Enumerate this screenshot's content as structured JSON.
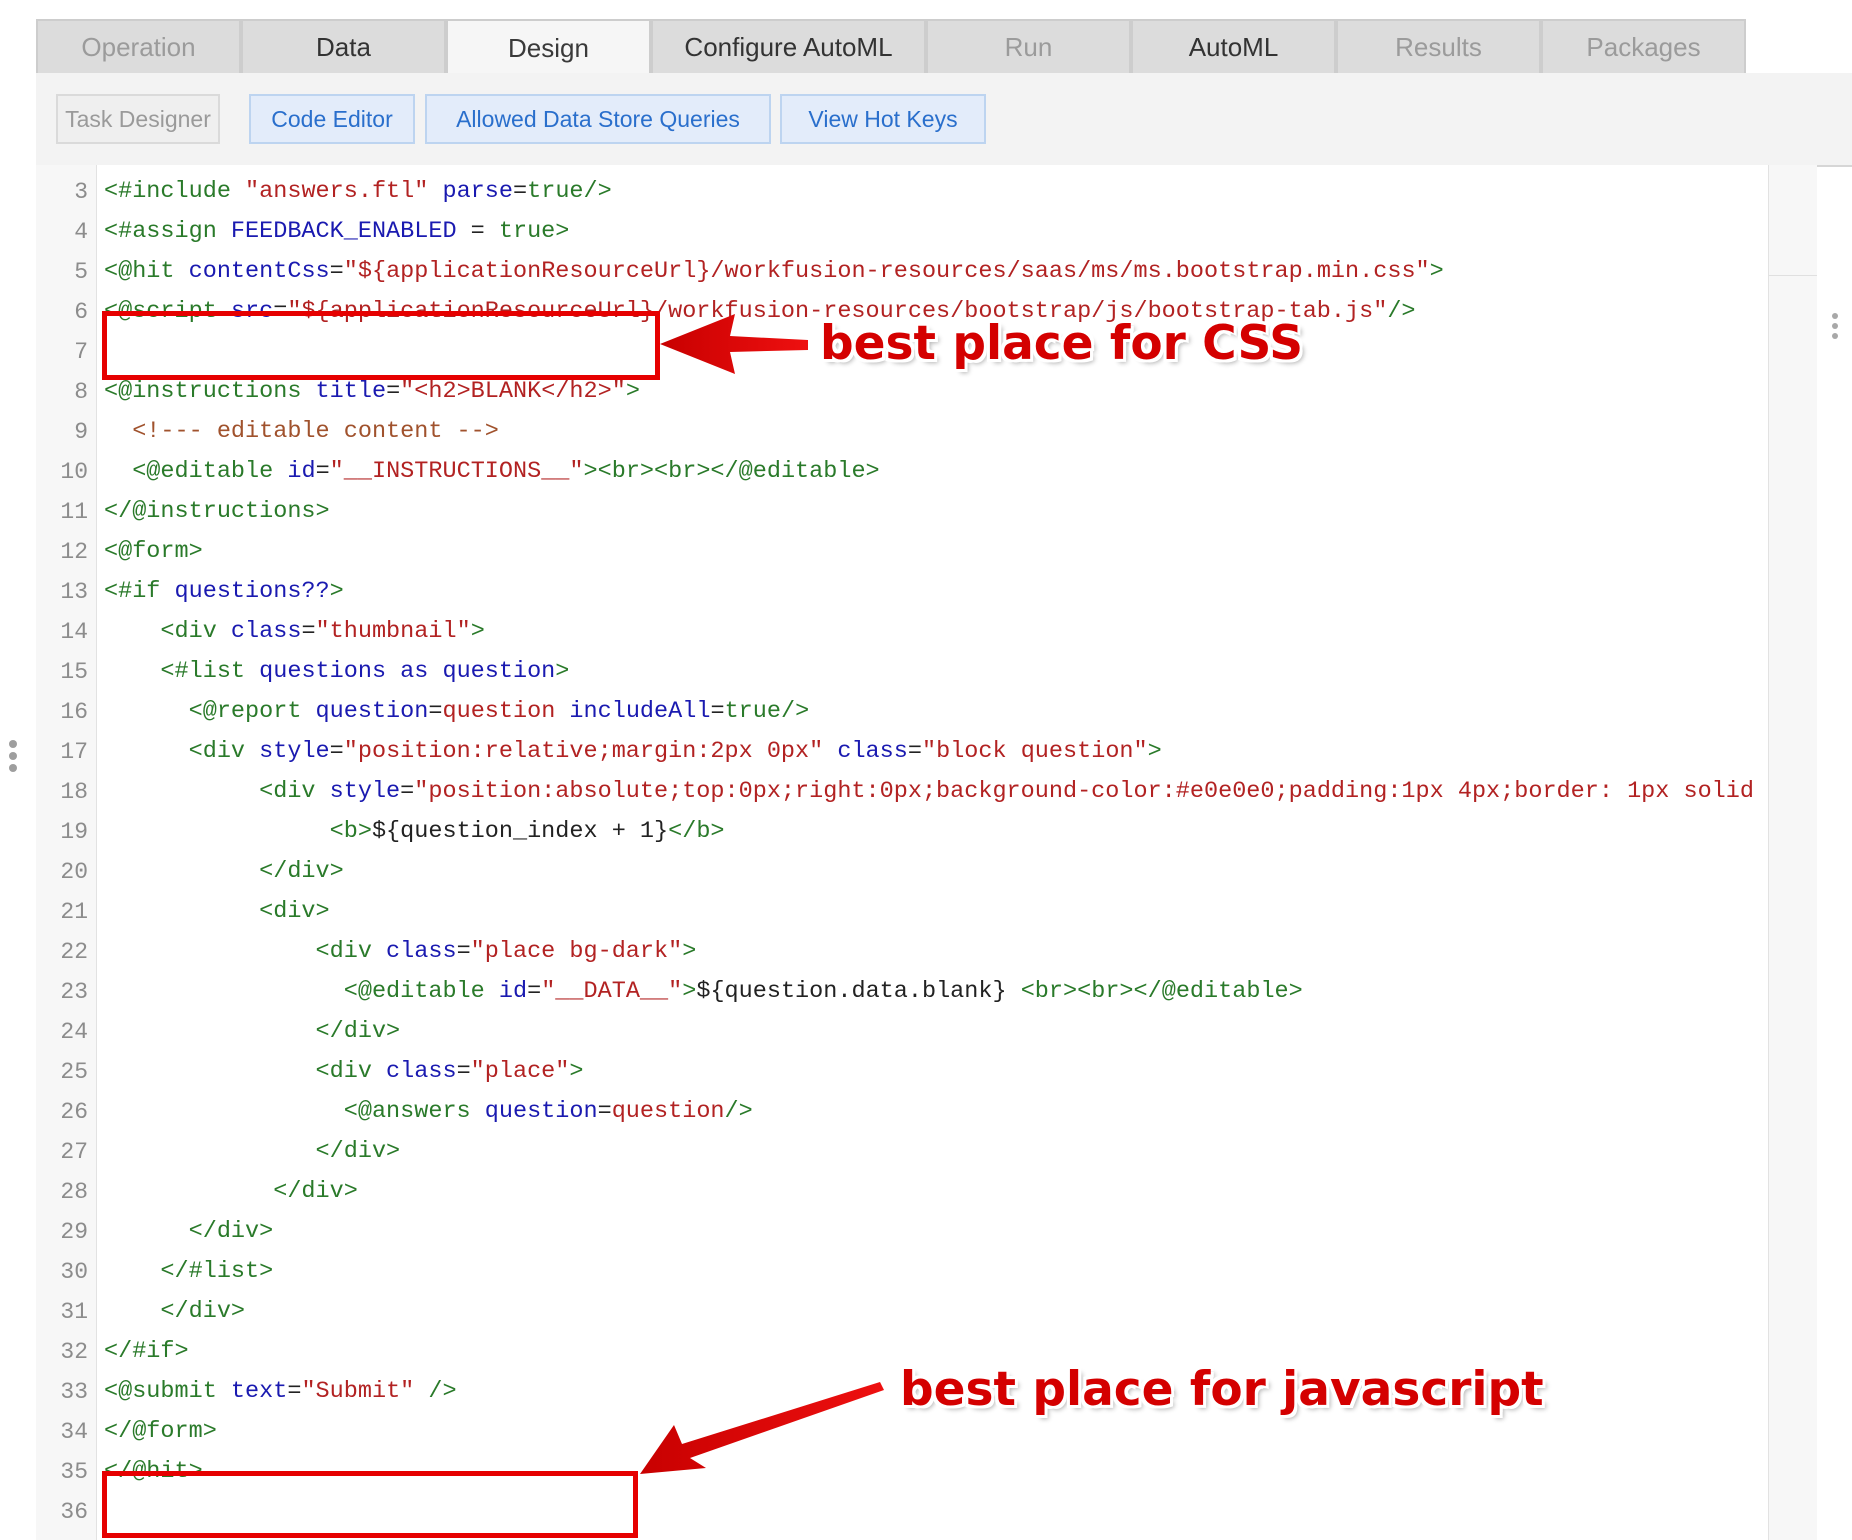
{
  "tabs": [
    {
      "label": "Operation",
      "state": "muted"
    },
    {
      "label": "Data",
      "state": "normal"
    },
    {
      "label": "Design",
      "state": "active"
    },
    {
      "label": "Configure AutoML",
      "state": "normal"
    },
    {
      "label": "Run",
      "state": "muted"
    },
    {
      "label": "AutoML",
      "state": "normal"
    },
    {
      "label": "Results",
      "state": "muted"
    },
    {
      "label": "Packages",
      "state": "muted"
    }
  ],
  "toolbar": {
    "task_designer": "Task Designer",
    "code_editor": "Code Editor",
    "allowed_queries": "Allowed Data Store Queries",
    "hot_keys": "View Hot Keys"
  },
  "colors": {
    "directive": "#2a7a2a",
    "name": "#1a1ab0",
    "string": "#b22222",
    "comment": "#a0522d",
    "plain": "#222222",
    "annotation": "#e60000"
  },
  "code_lines": [
    {
      "n": "3",
      "tokens": [
        [
          "d",
          "<#include "
        ],
        [
          "s",
          "\"answers.ftl\""
        ],
        [
          "n",
          " parse"
        ],
        [
          "p",
          "="
        ],
        [
          "d",
          "true/>"
        ]
      ]
    },
    {
      "n": "4",
      "tokens": [
        [
          "d",
          "<#assign "
        ],
        [
          "n",
          "FEEDBACK_ENABLED"
        ],
        [
          "p",
          " = "
        ],
        [
          "d",
          "true>"
        ]
      ]
    },
    {
      "n": "5",
      "tokens": [
        [
          "d",
          "<@hit "
        ],
        [
          "n",
          "contentCss"
        ],
        [
          "p",
          "="
        ],
        [
          "s",
          "\"${applicationResourceUrl}/workfusion-resources/saas/ms/ms.bootstrap.min.css\""
        ],
        [
          "d",
          ">"
        ]
      ]
    },
    {
      "n": "6",
      "tokens": [
        [
          "d",
          "<@script "
        ],
        [
          "n",
          "src"
        ],
        [
          "p",
          "="
        ],
        [
          "s",
          "\"${applicationResourceUrl}/workfusion-resources/bootstrap/js/bootstrap-tab.js\""
        ],
        [
          "d",
          "/>"
        ]
      ]
    },
    {
      "n": "7",
      "tokens": []
    },
    {
      "n": "8",
      "tokens": [
        [
          "d",
          "<@instructions "
        ],
        [
          "n",
          "title"
        ],
        [
          "p",
          "="
        ],
        [
          "s",
          "\"<h2>BLANK</h2>\""
        ],
        [
          "d",
          ">"
        ]
      ]
    },
    {
      "n": "9",
      "tokens": [
        [
          "c",
          "  <!--- editable content -->"
        ]
      ]
    },
    {
      "n": "10",
      "tokens": [
        [
          "d",
          "  <@editable "
        ],
        [
          "n",
          "id"
        ],
        [
          "p",
          "="
        ],
        [
          "s",
          "\"__INSTRUCTIONS__\""
        ],
        [
          "d",
          "><br><br></@editable>"
        ]
      ]
    },
    {
      "n": "11",
      "tokens": [
        [
          "d",
          "</@instructions>"
        ]
      ]
    },
    {
      "n": "12",
      "tokens": [
        [
          "d",
          "<@form>"
        ]
      ]
    },
    {
      "n": "13",
      "tokens": [
        [
          "d",
          "<#if "
        ],
        [
          "n",
          "questions??"
        ],
        [
          "d",
          ">"
        ]
      ]
    },
    {
      "n": "14",
      "tokens": [
        [
          "d",
          "    <div "
        ],
        [
          "n",
          "class"
        ],
        [
          "p",
          "="
        ],
        [
          "s",
          "\"thumbnail\""
        ],
        [
          "d",
          ">"
        ]
      ]
    },
    {
      "n": "15",
      "tokens": [
        [
          "d",
          "    <#list "
        ],
        [
          "n",
          "questions as question"
        ],
        [
          "d",
          ">"
        ]
      ]
    },
    {
      "n": "16",
      "tokens": [
        [
          "d",
          "      <@report "
        ],
        [
          "n",
          "question"
        ],
        [
          "p",
          "="
        ],
        [
          "s",
          "question"
        ],
        [
          "n",
          " includeAll"
        ],
        [
          "p",
          "="
        ],
        [
          "d",
          "true/>"
        ]
      ]
    },
    {
      "n": "17",
      "tokens": [
        [
          "d",
          "      <div "
        ],
        [
          "n",
          "style"
        ],
        [
          "p",
          "="
        ],
        [
          "s",
          "\"position:relative;margin:2px 0px\""
        ],
        [
          "n",
          " class"
        ],
        [
          "p",
          "="
        ],
        [
          "s",
          "\"block question\""
        ],
        [
          "d",
          ">"
        ]
      ]
    },
    {
      "n": "18",
      "tokens": [
        [
          "d",
          "           <div "
        ],
        [
          "n",
          "style"
        ],
        [
          "p",
          "="
        ],
        [
          "s",
          "\"position:absolute;top:0px;right:0px;background-color:#e0e0e0;padding:1px 4px;border: 1px solid"
        ]
      ]
    },
    {
      "n": "19",
      "tokens": [
        [
          "d",
          "                <b>"
        ],
        [
          "p",
          "${question_index + 1}"
        ],
        [
          "d",
          "</b>"
        ]
      ]
    },
    {
      "n": "20",
      "tokens": [
        [
          "d",
          "           </div>"
        ]
      ]
    },
    {
      "n": "21",
      "tokens": [
        [
          "d",
          "           <div>"
        ]
      ]
    },
    {
      "n": "22",
      "tokens": [
        [
          "d",
          "               <div "
        ],
        [
          "n",
          "class"
        ],
        [
          "p",
          "="
        ],
        [
          "s",
          "\"place bg-dark\""
        ],
        [
          "d",
          ">"
        ]
      ]
    },
    {
      "n": "23",
      "tokens": [
        [
          "d",
          "                 <@editable "
        ],
        [
          "n",
          "id"
        ],
        [
          "p",
          "="
        ],
        [
          "s",
          "\"__DATA__\""
        ],
        [
          "d",
          ">"
        ],
        [
          "p",
          "${question.data.blank} "
        ],
        [
          "d",
          "<br><br></@editable>"
        ]
      ]
    },
    {
      "n": "24",
      "tokens": [
        [
          "d",
          "               </div>"
        ]
      ]
    },
    {
      "n": "25",
      "tokens": [
        [
          "d",
          "               <div "
        ],
        [
          "n",
          "class"
        ],
        [
          "p",
          "="
        ],
        [
          "s",
          "\"place\""
        ],
        [
          "d",
          ">"
        ]
      ]
    },
    {
      "n": "26",
      "tokens": [
        [
          "d",
          "                 <@answers "
        ],
        [
          "n",
          "question"
        ],
        [
          "p",
          "="
        ],
        [
          "s",
          "question"
        ],
        [
          "d",
          "/>"
        ]
      ]
    },
    {
      "n": "27",
      "tokens": [
        [
          "d",
          "               </div>"
        ]
      ]
    },
    {
      "n": "28",
      "tokens": [
        [
          "d",
          "            </div>"
        ]
      ]
    },
    {
      "n": "29",
      "tokens": [
        [
          "d",
          "      </div>"
        ]
      ]
    },
    {
      "n": "30",
      "tokens": [
        [
          "d",
          "    </#list>"
        ]
      ]
    },
    {
      "n": "31",
      "tokens": [
        [
          "d",
          "    </div>"
        ]
      ]
    },
    {
      "n": "32",
      "tokens": [
        [
          "d",
          "</#if>"
        ]
      ]
    },
    {
      "n": "33",
      "tokens": [
        [
          "d",
          "<@submit "
        ],
        [
          "n",
          "text"
        ],
        [
          "p",
          "="
        ],
        [
          "s",
          "\"Submit\""
        ],
        [
          "d",
          " />"
        ]
      ]
    },
    {
      "n": "34",
      "tokens": [
        [
          "d",
          "</@form>"
        ]
      ]
    },
    {
      "n": "35",
      "tokens": [
        [
          "d",
          "</@hit>"
        ]
      ]
    },
    {
      "n": "36",
      "tokens": []
    }
  ],
  "annotations": {
    "css_label": "best place for CSS",
    "js_label": "best place for javascript"
  }
}
